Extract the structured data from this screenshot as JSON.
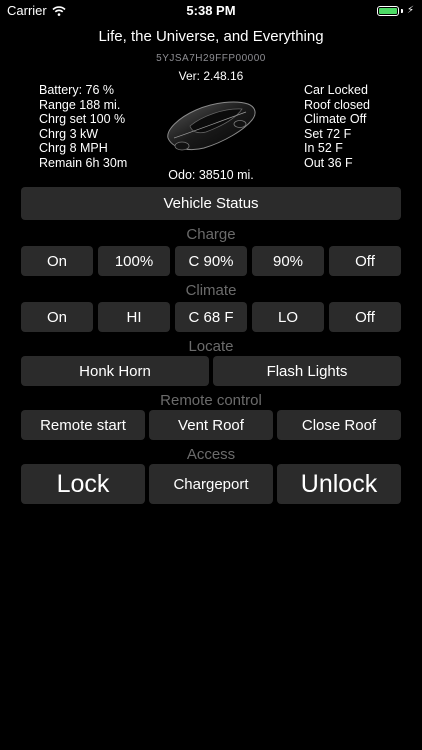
{
  "status_bar": {
    "carrier": "Carrier",
    "time": "5:38 PM",
    "icons": [
      "wifi-icon",
      "battery-icon",
      "charging-bolt-icon"
    ]
  },
  "header": {
    "title": "Life, the Universe, and Everything",
    "vin": "5YJSA7H29FFP00000",
    "version": "Ver: 2.48.16"
  },
  "info_left": [
    "Battery: 76 %",
    "Range 188 mi.",
    "Chrg set 100 %",
    "Chrg 3 kW",
    "Chrg 8 MPH",
    "Remain 6h 30m"
  ],
  "info_right": [
    "Car Locked",
    "Roof closed",
    "Climate Off",
    "Set 72 F",
    "In 52 F",
    "Out 36 F"
  ],
  "odometer": "Odo: 38510 mi.",
  "vehicle_status_button": "Vehicle Status",
  "charge": {
    "label": "Charge",
    "buttons": [
      "On",
      "100%",
      "C 90%",
      "90%",
      "Off"
    ]
  },
  "climate": {
    "label": "Climate",
    "buttons": [
      "On",
      "HI",
      "C 68 F",
      "LO",
      "Off"
    ]
  },
  "locate": {
    "label": "Locate",
    "buttons": [
      "Honk Horn",
      "Flash Lights"
    ]
  },
  "remote_control": {
    "label": "Remote control",
    "buttons": [
      "Remote start",
      "Vent Roof",
      "Close Roof"
    ]
  },
  "access": {
    "label": "Access",
    "buttons": [
      "Lock",
      "Chargeport",
      "Unlock"
    ]
  },
  "colors": {
    "background": "#000000",
    "button": "#2b2b2b",
    "section_label": "#6b6b6b",
    "battery": "#4cd964"
  }
}
